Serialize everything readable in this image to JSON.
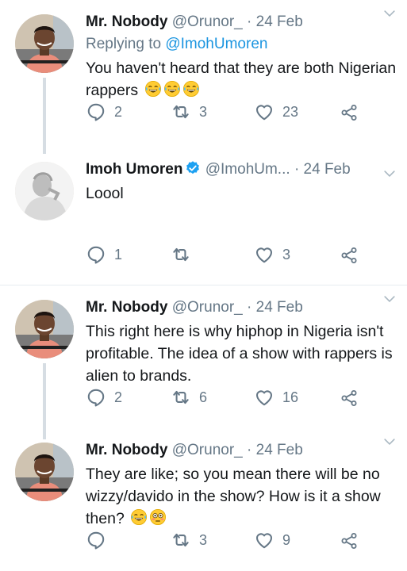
{
  "colors": {
    "accent": "#1b95e0",
    "muted": "#657786",
    "text": "#14171a",
    "thread": "#d6dde3"
  },
  "tweets": [
    {
      "name": "Mr. Nobody",
      "handle": "@Orunor_",
      "date": "· 24 Feb",
      "reply_prefix": "Replying to",
      "reply_mention": "@ImohUmoren",
      "text": "You haven't heard that they are both Nigerian rappers",
      "emojis": [
        "tears-of-joy",
        "tears-of-joy",
        "tears-of-joy"
      ],
      "replies": "2",
      "retweets": "3",
      "likes": "23"
    },
    {
      "name": "Imoh Umoren",
      "handle": "@ImohUm...",
      "date": "· 24 Feb",
      "verified": true,
      "text": "Loool",
      "replies": "1",
      "retweets": "",
      "likes": "3"
    },
    {
      "name": "Mr. Nobody",
      "handle": "@Orunor_",
      "date": "· 24 Feb",
      "text": "This right here is why hiphop in Nigeria isn't profitable. The idea of a show with rappers is alien to brands.",
      "replies": "2",
      "retweets": "6",
      "likes": "16"
    },
    {
      "name": "Mr. Nobody",
      "handle": "@Orunor_",
      "date": "· 24 Feb",
      "text": "They are like; so you mean there will be no wizzy/davido in the show? How is it a show then?",
      "emojis": [
        "tears-of-joy",
        "flushed-face"
      ],
      "replies": "",
      "retweets": "3",
      "likes": "9"
    }
  ]
}
